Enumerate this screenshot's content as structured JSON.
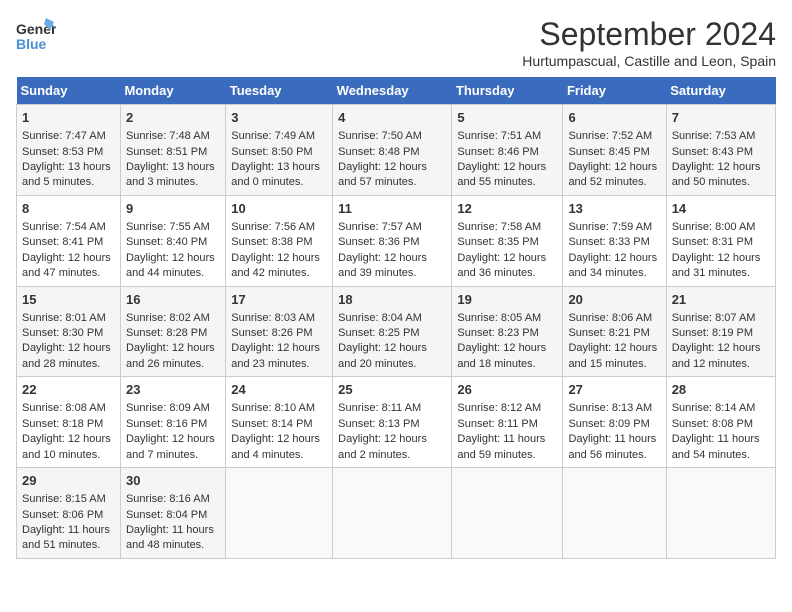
{
  "header": {
    "logo_line1": "General",
    "logo_line2": "Blue",
    "main_title": "September 2024",
    "subtitle": "Hurtumpascual, Castille and Leon, Spain"
  },
  "days_of_week": [
    "Sunday",
    "Monday",
    "Tuesday",
    "Wednesday",
    "Thursday",
    "Friday",
    "Saturday"
  ],
  "weeks": [
    [
      {
        "day": "1",
        "sunrise": "7:47 AM",
        "sunset": "8:53 PM",
        "daylight": "13 hours and 5 minutes."
      },
      {
        "day": "2",
        "sunrise": "7:48 AM",
        "sunset": "8:51 PM",
        "daylight": "13 hours and 3 minutes."
      },
      {
        "day": "3",
        "sunrise": "7:49 AM",
        "sunset": "8:50 PM",
        "daylight": "13 hours and 0 minutes."
      },
      {
        "day": "4",
        "sunrise": "7:50 AM",
        "sunset": "8:48 PM",
        "daylight": "12 hours and 57 minutes."
      },
      {
        "day": "5",
        "sunrise": "7:51 AM",
        "sunset": "8:46 PM",
        "daylight": "12 hours and 55 minutes."
      },
      {
        "day": "6",
        "sunrise": "7:52 AM",
        "sunset": "8:45 PM",
        "daylight": "12 hours and 52 minutes."
      },
      {
        "day": "7",
        "sunrise": "7:53 AM",
        "sunset": "8:43 PM",
        "daylight": "12 hours and 50 minutes."
      }
    ],
    [
      {
        "day": "8",
        "sunrise": "7:54 AM",
        "sunset": "8:41 PM",
        "daylight": "12 hours and 47 minutes."
      },
      {
        "day": "9",
        "sunrise": "7:55 AM",
        "sunset": "8:40 PM",
        "daylight": "12 hours and 44 minutes."
      },
      {
        "day": "10",
        "sunrise": "7:56 AM",
        "sunset": "8:38 PM",
        "daylight": "12 hours and 42 minutes."
      },
      {
        "day": "11",
        "sunrise": "7:57 AM",
        "sunset": "8:36 PM",
        "daylight": "12 hours and 39 minutes."
      },
      {
        "day": "12",
        "sunrise": "7:58 AM",
        "sunset": "8:35 PM",
        "daylight": "12 hours and 36 minutes."
      },
      {
        "day": "13",
        "sunrise": "7:59 AM",
        "sunset": "8:33 PM",
        "daylight": "12 hours and 34 minutes."
      },
      {
        "day": "14",
        "sunrise": "8:00 AM",
        "sunset": "8:31 PM",
        "daylight": "12 hours and 31 minutes."
      }
    ],
    [
      {
        "day": "15",
        "sunrise": "8:01 AM",
        "sunset": "8:30 PM",
        "daylight": "12 hours and 28 minutes."
      },
      {
        "day": "16",
        "sunrise": "8:02 AM",
        "sunset": "8:28 PM",
        "daylight": "12 hours and 26 minutes."
      },
      {
        "day": "17",
        "sunrise": "8:03 AM",
        "sunset": "8:26 PM",
        "daylight": "12 hours and 23 minutes."
      },
      {
        "day": "18",
        "sunrise": "8:04 AM",
        "sunset": "8:25 PM",
        "daylight": "12 hours and 20 minutes."
      },
      {
        "day": "19",
        "sunrise": "8:05 AM",
        "sunset": "8:23 PM",
        "daylight": "12 hours and 18 minutes."
      },
      {
        "day": "20",
        "sunrise": "8:06 AM",
        "sunset": "8:21 PM",
        "daylight": "12 hours and 15 minutes."
      },
      {
        "day": "21",
        "sunrise": "8:07 AM",
        "sunset": "8:19 PM",
        "daylight": "12 hours and 12 minutes."
      }
    ],
    [
      {
        "day": "22",
        "sunrise": "8:08 AM",
        "sunset": "8:18 PM",
        "daylight": "12 hours and 10 minutes."
      },
      {
        "day": "23",
        "sunrise": "8:09 AM",
        "sunset": "8:16 PM",
        "daylight": "12 hours and 7 minutes."
      },
      {
        "day": "24",
        "sunrise": "8:10 AM",
        "sunset": "8:14 PM",
        "daylight": "12 hours and 4 minutes."
      },
      {
        "day": "25",
        "sunrise": "8:11 AM",
        "sunset": "8:13 PM",
        "daylight": "12 hours and 2 minutes."
      },
      {
        "day": "26",
        "sunrise": "8:12 AM",
        "sunset": "8:11 PM",
        "daylight": "11 hours and 59 minutes."
      },
      {
        "day": "27",
        "sunrise": "8:13 AM",
        "sunset": "8:09 PM",
        "daylight": "11 hours and 56 minutes."
      },
      {
        "day": "28",
        "sunrise": "8:14 AM",
        "sunset": "8:08 PM",
        "daylight": "11 hours and 54 minutes."
      }
    ],
    [
      {
        "day": "29",
        "sunrise": "8:15 AM",
        "sunset": "8:06 PM",
        "daylight": "11 hours and 51 minutes."
      },
      {
        "day": "30",
        "sunrise": "8:16 AM",
        "sunset": "8:04 PM",
        "daylight": "11 hours and 48 minutes."
      },
      null,
      null,
      null,
      null,
      null
    ]
  ]
}
